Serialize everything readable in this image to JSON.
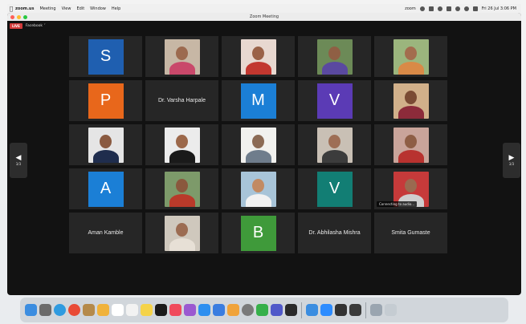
{
  "menubar": {
    "app": "zoom.us",
    "items": [
      "Meeting",
      "View",
      "Edit",
      "Window",
      "Help"
    ],
    "status_left": "zoom",
    "clock": "Fri 26 Jul 3:06 PM"
  },
  "window": {
    "title": "Zoom Meeting",
    "live_badge": "LIVE",
    "stream_target": "Facebook"
  },
  "gallery": {
    "prev_page": "3/3",
    "next_page": "3/3",
    "tiles": [
      {
        "kind": "avatar",
        "letter": "S",
        "color": "#1f5fb0"
      },
      {
        "kind": "photo",
        "bg": "#c7b7a5",
        "skin": "#9c6a4f",
        "cloth": "#c9486a"
      },
      {
        "kind": "photo",
        "bg": "#e8d8d0",
        "skin": "#9a6248",
        "cloth": "#c2372f"
      },
      {
        "kind": "photo",
        "bg": "#6c8a57",
        "skin": "#8f5f44",
        "cloth": "#5a49a0"
      },
      {
        "kind": "photo",
        "bg": "#9bb57d",
        "skin": "#a36c4e",
        "cloth": "#d98a47"
      },
      {
        "kind": "avatar",
        "letter": "P",
        "color": "#e8671b"
      },
      {
        "kind": "name",
        "name": "Dr. Varsha Harpale"
      },
      {
        "kind": "avatar",
        "letter": "M",
        "color": "#1b7fd6"
      },
      {
        "kind": "avatar",
        "letter": "V",
        "color": "#5b3bb5"
      },
      {
        "kind": "photo",
        "bg": "#d1b08a",
        "skin": "#7a4b34",
        "cloth": "#8c2b3a"
      },
      {
        "kind": "photo",
        "bg": "#e5e5e5",
        "skin": "#8a5a40",
        "cloth": "#1f2d4d"
      },
      {
        "kind": "photo",
        "bg": "#ececec",
        "skin": "#9c684a",
        "cloth": "#1a1a1a"
      },
      {
        "kind": "photo",
        "bg": "#f1f1ee",
        "skin": "#8b6a54",
        "cloth": "#6f7d8c"
      },
      {
        "kind": "photo",
        "bg": "#c9c0b5",
        "skin": "#9e6e55",
        "cloth": "#3c3c3c"
      },
      {
        "kind": "photo",
        "bg": "#c9a49a",
        "skin": "#8e5e45",
        "cloth": "#b8322f"
      },
      {
        "kind": "avatar",
        "letter": "A",
        "color": "#1b7fd6"
      },
      {
        "kind": "photo",
        "bg": "#7d9a6a",
        "skin": "#8a583d",
        "cloth": "#b93a2a"
      },
      {
        "kind": "photo",
        "bg": "#a8c4d8",
        "skin": "#c28a62",
        "cloth": "#f2f2f2"
      },
      {
        "kind": "avatar",
        "letter": "V",
        "color": "#127e74"
      },
      {
        "kind": "photo",
        "bg": "#c63a3a",
        "skin": "#9a6a50",
        "cloth": "#cfcfcf",
        "status": "Connecting to audio..."
      },
      {
        "kind": "name",
        "name": "Aman Kamble"
      },
      {
        "kind": "photo",
        "bg": "#cfc8bd",
        "skin": "#9c6c52",
        "cloth": "#e7e0d6"
      },
      {
        "kind": "avatar",
        "letter": "B",
        "color": "#3f9a3a"
      },
      {
        "kind": "name",
        "name": "Dr. Abhilasha Mishra"
      },
      {
        "kind": "name",
        "name": "Smita Gumaste"
      }
    ]
  },
  "dock": {
    "icons": [
      "finder",
      "launchpad",
      "safari",
      "chrome",
      "notes-brown",
      "photos",
      "calendar",
      "reminders",
      "notes",
      "tv",
      "music",
      "podcasts",
      "app-store",
      "keynote",
      "pages",
      "settings",
      "numbers",
      "teams",
      "monitor",
      "preview",
      "zoom",
      "calculator",
      "activity",
      "downloads",
      "trash"
    ],
    "colors": [
      "#3b8de0",
      "#6b6b6b",
      "#2f9be0",
      "#e94b36",
      "#b58a4a",
      "#f0b23a",
      "#ffffff",
      "#f2f2f2",
      "#f5d34a",
      "#1a1a1a",
      "#f04a5c",
      "#9b59d0",
      "#2d8ff0",
      "#3a7de0",
      "#f0a33a",
      "#7a7a7a",
      "#36b04a",
      "#5059c9",
      "#2a2a2a",
      "#3b8de0",
      "#2d8cff",
      "#333333",
      "#3a3a3a",
      "#9aa5b0",
      "#c5ccd2"
    ]
  }
}
